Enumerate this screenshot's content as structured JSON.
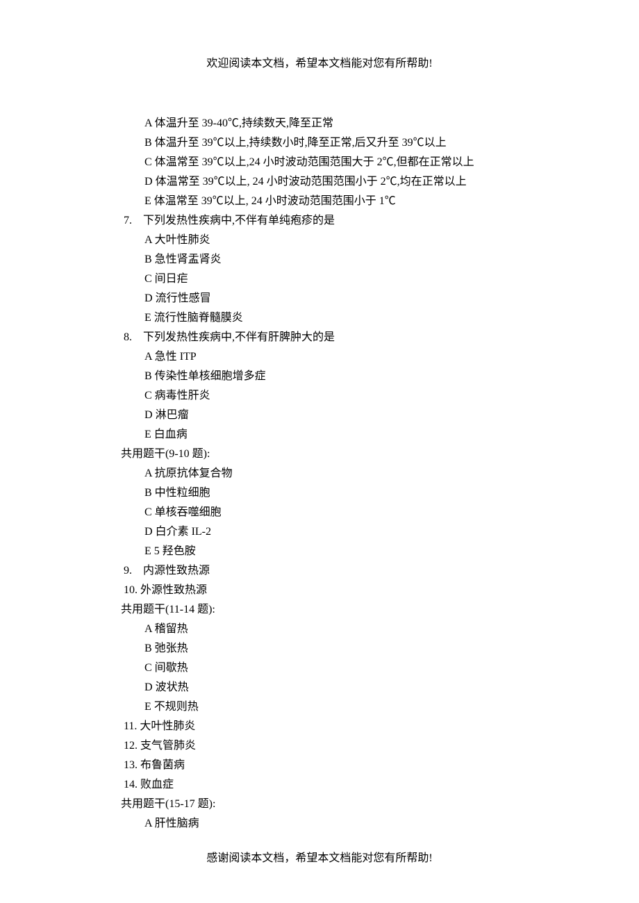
{
  "header": "欢迎阅读本文档，希望本文档能对您有所帮助!",
  "footer": "感谢阅读本文档，希望本文档能对您有所帮助!",
  "q6_options": {
    "A": "体温升至 39-40℃,持续数天,降至正常",
    "B": "体温升至 39℃以上,持续数小时,降至正常,后又升至 39℃以上",
    "C": "体温常至 39℃以上,24 小时波动范围范围大于 2℃,但都在正常以上",
    "D": "体温常至 39℃以上, 24 小时波动范围范围小于 2℃,均在正常以上",
    "E": "体温常至 39℃以上, 24 小时波动范围范围小于 1℃"
  },
  "q7": {
    "num": "7.",
    "text": "下列发热性疾病中,不伴有单纯疱疹的是",
    "options": {
      "A": "大叶性肺炎",
      "B": "急性肾盂肾炎",
      "C": "间日疟",
      "D": "流行性感冒",
      "E": "流行性脑脊髓膜炎"
    }
  },
  "q8": {
    "num": "8.",
    "text": "下列发热性疾病中,不伴有肝脾肿大的是",
    "options": {
      "A_prefix": "急性 ",
      "A_latin": "ITP",
      "B": "传染性单核细胞增多症",
      "C": "病毒性肝炎",
      "D": "淋巴瘤",
      "E": "白血病"
    }
  },
  "shared_9_10": {
    "title": "共用题干(9-10 题):",
    "options": {
      "A": "抗原抗体复合物",
      "B": "中性粒细胞",
      "C": "单核吞噬细胞",
      "D_prefix": "白介素 ",
      "D_latin": "IL-2",
      "E_sp": "  ",
      "E_latin": "5 ",
      "E_text": "羟色胺"
    }
  },
  "q9": {
    "num": "9.",
    "text": "内源性致热源"
  },
  "q10": {
    "num": "10. ",
    "text": "外源性致热源"
  },
  "shared_11_14": {
    "title": "共用题干(11-14 题):",
    "options": {
      "A": "稽留热",
      "B": "弛张热",
      "C": "间歇热",
      "D": "波状热",
      "E": "不规则热"
    }
  },
  "q11": {
    "num": "11. ",
    "text": "大叶性肺炎"
  },
  "q12": {
    "num": "12. ",
    "text": "支气管肺炎"
  },
  "q13": {
    "num": "13. ",
    "text": "布鲁菌病"
  },
  "q14": {
    "num": "14. ",
    "text": "败血症"
  },
  "shared_15_17": {
    "title": "共用题干(15-17 题):",
    "options": {
      "A": "肝性脑病"
    }
  },
  "letters": {
    "A": "A  ",
    "B": "B  ",
    "C": "C  ",
    "D": "D  ",
    "E": "E  "
  }
}
